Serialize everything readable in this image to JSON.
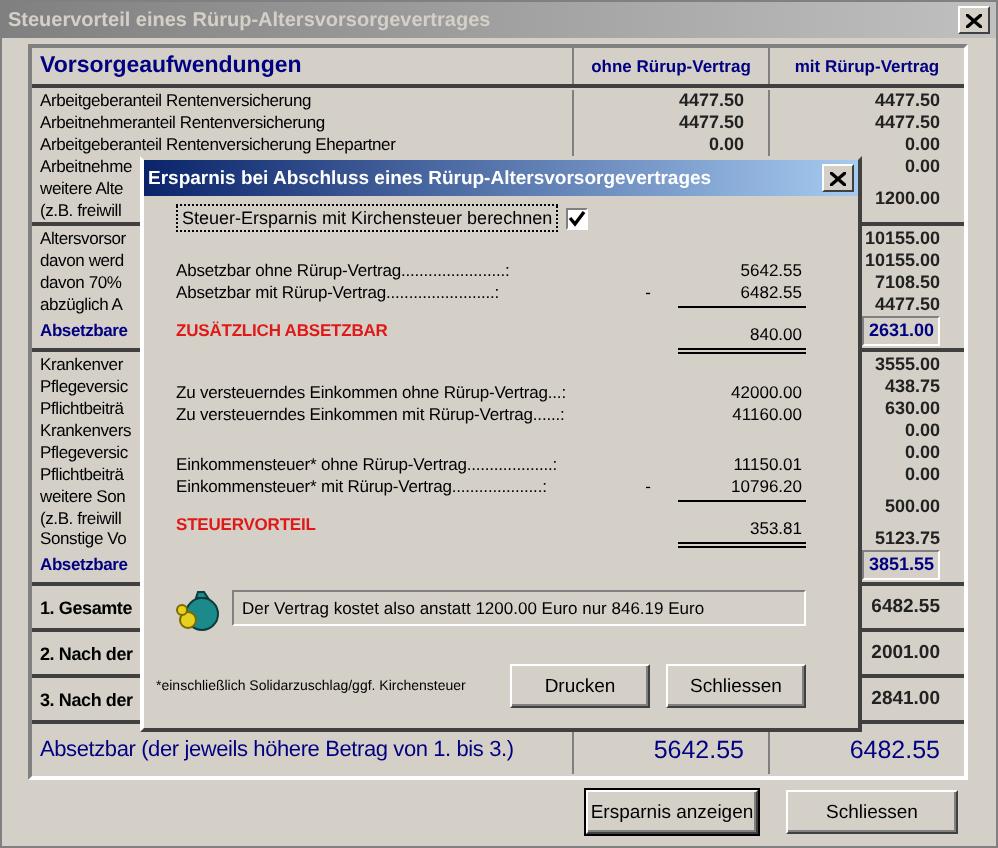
{
  "window": {
    "title": "Steuervorteil eines Rürup-Altersvorsorgevertrages"
  },
  "table": {
    "columns": [
      "Vorsorgeaufwendungen",
      "ohne Rürup-Vertrag",
      "mit Rürup-Vertrag"
    ],
    "groups": [
      {
        "rows": [
          {
            "kind": "item",
            "label": "Arbeitgeberanteil   Rentenversicherung",
            "without": "4477.50",
            "with": "4477.50"
          },
          {
            "kind": "item",
            "label": "Arbeitnehmeranteil Rentenversicherung",
            "without": "4477.50",
            "with": "4477.50"
          },
          {
            "kind": "item",
            "label": "Arbeitgeberanteil   Rentenversicherung Ehepartner",
            "without": "0.00",
            "with": "0.00"
          },
          {
            "kind": "item",
            "label": "Arbeitnehme",
            "with": "0.00"
          },
          {
            "kind": "item",
            "label": "weitere Alte\n(z.B. freiwill",
            "with": "1200.00"
          }
        ]
      },
      {
        "rows": [
          {
            "kind": "item",
            "label": "Altersvorsor",
            "with": "10155.00"
          },
          {
            "kind": "item",
            "label": "davon werd",
            "with": "10155.00"
          },
          {
            "kind": "item",
            "label": "davon 70%",
            "with": "7108.50"
          },
          {
            "kind": "item",
            "label": "abzüglich A",
            "with": "4477.50"
          },
          {
            "kind": "total",
            "label": "Absetzbare",
            "with": "2631.00"
          }
        ]
      },
      {
        "rows": [
          {
            "kind": "item",
            "label": "Krankenver",
            "with": "3555.00"
          },
          {
            "kind": "item",
            "label": "Pflegeversic",
            "with": "438.75"
          },
          {
            "kind": "item",
            "label": "Pflichtbeiträ",
            "with": "630.00"
          },
          {
            "kind": "item",
            "label": "Krankenvers",
            "with": "0.00"
          },
          {
            "kind": "item",
            "label": "Pflegeversic",
            "with": "0.00"
          },
          {
            "kind": "item",
            "label": "Pflichtbeiträ",
            "with": "0.00"
          },
          {
            "kind": "item",
            "label": "weitere Son\n(z.B. freiwill",
            "with": "500.00"
          },
          {
            "kind": "sub",
            "label": "Sonstige Vo",
            "with": "5123.75"
          },
          {
            "kind": "total",
            "label": "Absetzbare",
            "with": "3851.55"
          }
        ]
      },
      {
        "rows": [
          {
            "kind": "summary",
            "label": "1. Gesamte",
            "with": "6482.55"
          }
        ]
      },
      {
        "rows": [
          {
            "kind": "summary",
            "label": "2. Nach der",
            "with": "2001.00"
          }
        ]
      },
      {
        "rows": [
          {
            "kind": "summary",
            "label": "3. Nach der",
            "with": "2841.00"
          }
        ]
      },
      {
        "rows": [
          {
            "kind": "final",
            "label": "Absetzbar (der jeweils höhere Betrag von 1. bis 3.)",
            "without": "5642.55",
            "with": "6482.55"
          }
        ]
      }
    ]
  },
  "buttons": [
    "Ersparnis anzeigen",
    "Schliessen"
  ],
  "dialog": {
    "title": "Ersparnis bei Abschluss eines Rürup-Altersvorsorgevertrages",
    "checkbox": {
      "label": "Steuer-Ersparnis mit Kirchensteuer berechnen",
      "checked": true
    },
    "blocks": [
      [
        {
          "kind": "line",
          "label": "Absetzbar ohne Rürup-Vertrag.......................:",
          "value": "5642.55"
        },
        {
          "kind": "line",
          "label": "Absetzbar mit Rürup-Vertrag........................:",
          "sign": "-",
          "value": "6482.55",
          "underlined": true
        },
        {
          "kind": "result",
          "label": "ZUSÄTZLICH ABSETZBAR",
          "value": "840.00",
          "double_underlined": true
        }
      ],
      [
        {
          "kind": "line",
          "label": "Zu versteuerndes Einkommen ohne Rürup-Vertrag...:",
          "value": "42000.00"
        },
        {
          "kind": "line",
          "label": "Zu versteuerndes Einkommen mit Rürup-Vertrag......:",
          "value": "41160.00"
        }
      ],
      [
        {
          "kind": "line",
          "label": "Einkommensteuer* ohne Rürup-Vertrag...................:",
          "value": "11150.01"
        },
        {
          "kind": "line",
          "label": "Einkommensteuer* mit Rürup-Vertrag....................:",
          "sign": "-",
          "value": "10796.20",
          "underlined": true
        },
        {
          "kind": "result",
          "label": "STEUERVORTEIL",
          "value": "353.81",
          "double_underlined": true
        }
      ]
    ],
    "message": "Der Vertrag kostet also anstatt 1200.00 Euro nur 846.19 Euro",
    "footnote": "*einschließlich Solidarzuschlag/ggf. Kirchensteuer",
    "buttons": [
      "Drucken",
      "Schliessen"
    ]
  }
}
